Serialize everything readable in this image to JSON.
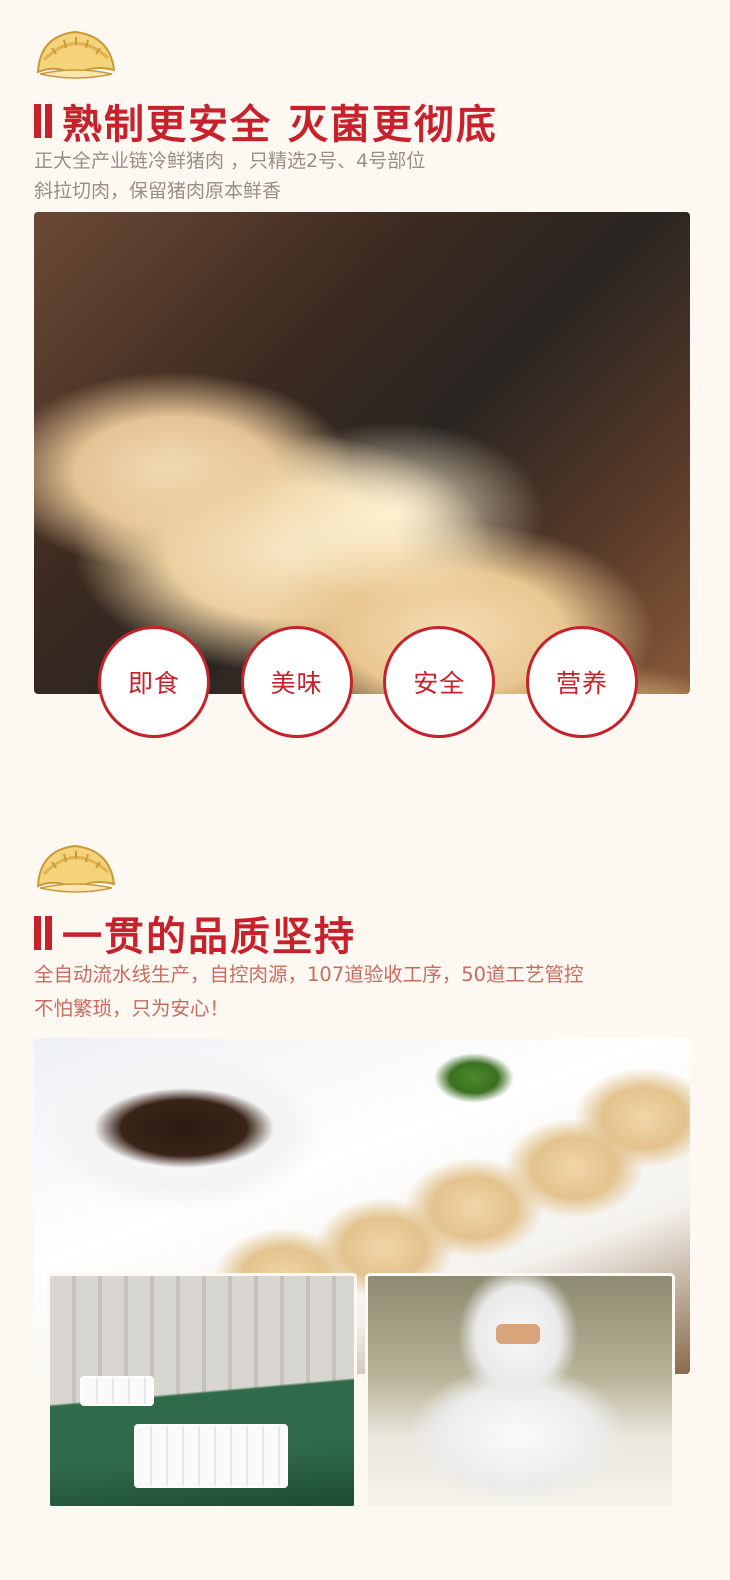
{
  "section1": {
    "icon": "dumpling-icon",
    "title": "熟制更安全 灭菌更彻底",
    "desc": [
      "正大全产业链冷鲜猪肉 ，只精选2号、4号部位",
      "斜拉切肉，保留猪肉原本鲜香"
    ],
    "photo": "pan-fried-dumplings-photo",
    "badges": [
      "即食",
      "美味",
      "安全",
      "营养"
    ]
  },
  "section2": {
    "icon": "dumpling-icon",
    "title": "一贯的品质坚持",
    "desc": [
      "全自动流水线生产，自控肉源，107道验收工序，50道工艺管控",
      "不怕繁琐，只为安心！"
    ],
    "photos": [
      "dumplings-on-plate-photo",
      "production-line-photo",
      "worker-photo"
    ]
  },
  "colors": {
    "accent": "#c7212b",
    "background": "#fdf8f2",
    "text_muted": "#9a8f86"
  }
}
